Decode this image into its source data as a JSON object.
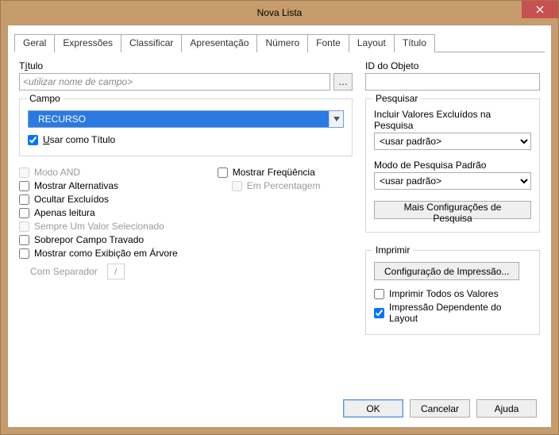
{
  "window": {
    "title": "Nova Lista"
  },
  "tabs": [
    "Geral",
    "Expressões",
    "Classificar",
    "Apresentação",
    "Número",
    "Fonte",
    "Layout",
    "Título"
  ],
  "active_tab": 0,
  "title_field": {
    "label_pre": "T",
    "label_u": "í",
    "label_post": "tulo",
    "placeholder": "<utilizar nome de campo>"
  },
  "obj_id": {
    "label": "ID do Objeto",
    "value": ""
  },
  "campo": {
    "legend": "Campo",
    "value": "RECURSO",
    "use_as_title_pre": "",
    "use_as_title_u": "U",
    "use_as_title_post": "sar como Título",
    "use_as_title_checked": true
  },
  "options_left1": {
    "modo_and": {
      "label": "Modo AND",
      "checked": false,
      "disabled": true
    },
    "mostrar_alt": {
      "label": "Mostrar Alternativas",
      "checked": false
    },
    "ocultar_excl": {
      "label": "Ocultar Excluídos",
      "checked": false
    },
    "apenas_leitura": {
      "label": "Apenas leitura",
      "checked": false
    },
    "sempre_um": {
      "label": "Sempre Um Valor Selecionado",
      "checked": false,
      "disabled": true
    },
    "sobrepor": {
      "label": "Sobrepor Campo Travado",
      "checked": false
    },
    "arvore": {
      "label": "Mostrar como Exibição em Árvore",
      "checked": false
    },
    "com_sep": {
      "label": "Com Separador",
      "value": "/"
    }
  },
  "options_left2": {
    "mostrar_freq": {
      "label": "Mostrar Freqüência",
      "checked": false
    },
    "em_pct": {
      "label": "Em Percentagem",
      "checked": false,
      "disabled": true
    }
  },
  "pesquisar": {
    "legend": "Pesquisar",
    "incluir_label": "Incluir Valores Excluídos na Pesquisa",
    "incluir_value": "<usar padrão>",
    "modo_label": "Modo de Pesquisa Padrão",
    "modo_value": "<usar padrão>",
    "mais_btn": "Mais Configurações de Pesquisa"
  },
  "imprimir": {
    "legend": "Imprimir",
    "config_btn": "Configuração de Impressão...",
    "todos": {
      "label": "Imprimir Todos os Valores",
      "checked": false
    },
    "dep_layout": {
      "label": "Impressão Dependente do Layout",
      "checked": true
    }
  },
  "buttons": {
    "ok": "OK",
    "cancel": "Cancelar",
    "help": "Ajuda"
  }
}
